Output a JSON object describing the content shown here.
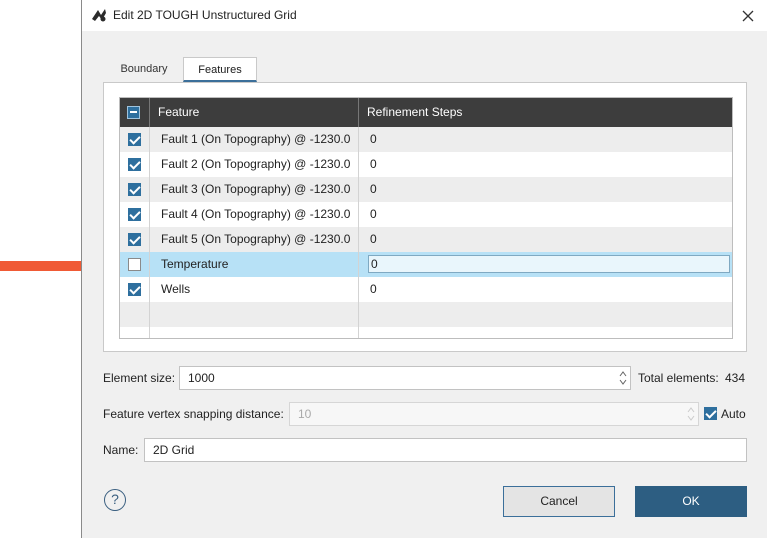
{
  "window": {
    "title": "Edit 2D TOUGH Unstructured Grid",
    "app_icon": "leapfrog-app-icon",
    "close_icon": "close-icon"
  },
  "tabs": [
    {
      "label": "Boundary",
      "selected": false
    },
    {
      "label": "Features",
      "selected": true
    }
  ],
  "grid": {
    "header_checkbox_state": "partial",
    "columns": [
      "Feature",
      "Refinement Steps"
    ],
    "rows": [
      {
        "checked": true,
        "feature": "Fault 1 (On Topography) @ -1230.0",
        "steps": "0"
      },
      {
        "checked": true,
        "feature": "Fault 2 (On Topography) @ -1230.0",
        "steps": "0"
      },
      {
        "checked": true,
        "feature": "Fault 3 (On Topography) @ -1230.0",
        "steps": "0"
      },
      {
        "checked": true,
        "feature": "Fault 4 (On Topography) @ -1230.0",
        "steps": "0"
      },
      {
        "checked": true,
        "feature": "Fault 5 (On Topography) @ -1230.0",
        "steps": "0"
      },
      {
        "checked": false,
        "feature": "Temperature",
        "steps": "0",
        "selected": true
      },
      {
        "checked": true,
        "feature": "Wells",
        "steps": "0"
      }
    ]
  },
  "form": {
    "element_size_label": "Element size:",
    "element_size_value": "1000",
    "total_elements_label": "Total elements:",
    "total_elements_value": "434",
    "snapping_label": "Feature vertex snapping distance:",
    "snapping_value": "10",
    "auto_label": "Auto",
    "auto_checked": true,
    "name_label": "Name:",
    "name_value": "2D Grid"
  },
  "buttons": {
    "help": "?",
    "cancel": "Cancel",
    "ok": "OK"
  },
  "colors": {
    "accent": "#2e6f9e",
    "ok_button": "#2d5e82",
    "header_bg": "#3d3d3d",
    "selected_row": "#b7e1f6",
    "annotation_arrow": "#f05a35"
  }
}
